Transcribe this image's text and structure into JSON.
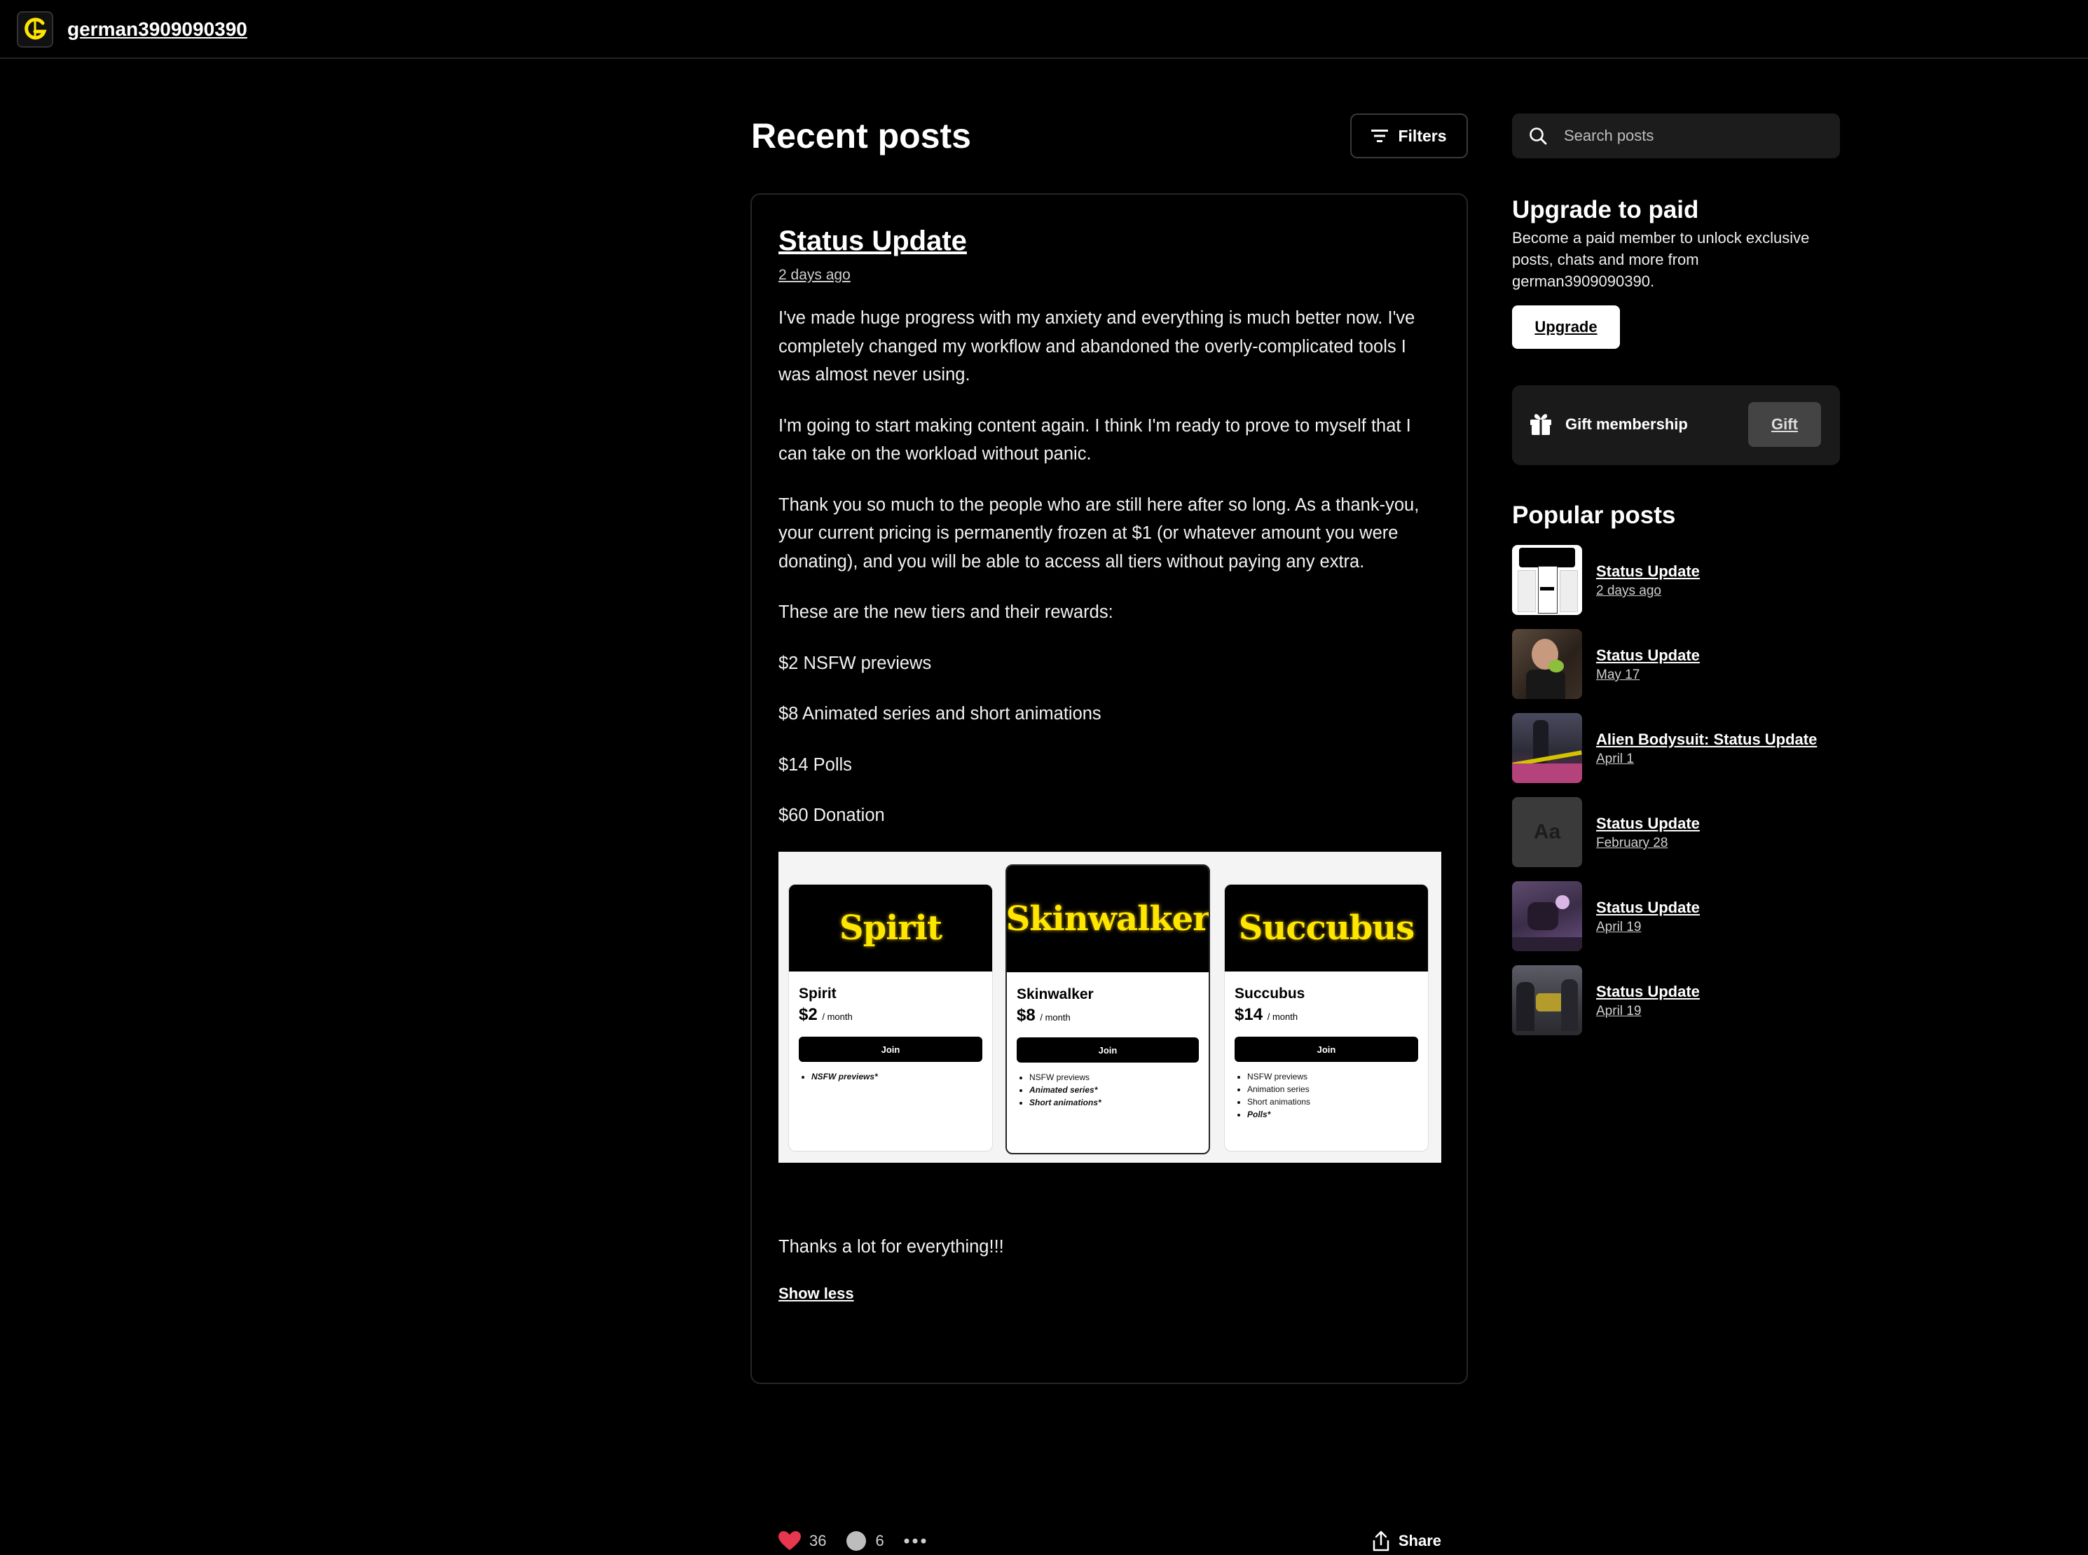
{
  "creator": {
    "name": "german3909090390"
  },
  "main": {
    "heading": "Recent posts",
    "filters_label": "Filters"
  },
  "post": {
    "title": "Status Update",
    "date": "2 days ago",
    "paragraphs": [
      "I've made huge progress with my anxiety and everything is much better now. I've completely changed my workflow and abandoned the overly-complicated tools I was almost never using.",
      "I'm going to start making content again. I think I'm ready to prove to myself that I can take on the workload without panic.",
      "Thank you so much to the people who are still here after so long. As a thank-you, your current pricing is permanently frozen at $1 (or whatever amount you were donating), and you will be able to access all tiers without paying any extra.",
      "These are the new tiers and their rewards:",
      "$2 NSFW previews",
      "$8 Animated series and short animations",
      "$14 Polls",
      "$60 Donation"
    ],
    "image_tiers": [
      {
        "banner": "Spirit",
        "name": "Spirit",
        "price": "$2",
        "per": "/ month",
        "join": "Join",
        "perks": [
          {
            "text": "NSFW previews*",
            "em": true
          }
        ]
      },
      {
        "banner": "Skinwalker",
        "name": "Skinwalker",
        "price": "$8",
        "per": "/ month",
        "join": "Join",
        "perks": [
          {
            "text": "NSFW previews",
            "em": false
          },
          {
            "text": "Animated series*",
            "em": true
          },
          {
            "text": "Short animations*",
            "em": true
          }
        ]
      },
      {
        "banner": "Succubus",
        "name": "Succubus",
        "price": "$14",
        "per": "/ month",
        "join": "Join",
        "perks": [
          {
            "text": "NSFW previews",
            "em": false
          },
          {
            "text": "Animation series",
            "em": false
          },
          {
            "text": "Short animations",
            "em": false
          },
          {
            "text": "Polls*",
            "em": true
          }
        ]
      }
    ],
    "closing": "Thanks a lot for everything!!!",
    "show_less": "Show less",
    "likes": "36",
    "comments": "6",
    "share_label": "Share"
  },
  "sidebar": {
    "search_placeholder": "Search posts",
    "upgrade": {
      "title": "Upgrade to paid",
      "description": "Become a paid member to unlock exclusive posts, chats and more from german3909090390.",
      "button": "Upgrade"
    },
    "gift": {
      "label": "Gift membership",
      "button": "Gift"
    },
    "popular": {
      "title": "Popular posts",
      "items": [
        {
          "title": "Status Update",
          "date": "2 days ago",
          "thumb": "tiers-screenshot"
        },
        {
          "title": "Status Update",
          "date": "May 17",
          "thumb": "character-photo"
        },
        {
          "title": "Alien Bodysuit: Status Update",
          "date": "April 1",
          "thumb": "scene-render"
        },
        {
          "title": "Status Update",
          "date": "February 28",
          "thumb": "text-placeholder",
          "placeholder_text": "Aa"
        },
        {
          "title": "Status Update",
          "date": "April 19",
          "thumb": "scene-render-purple"
        },
        {
          "title": "Status Update",
          "date": "April 19",
          "thumb": "scene-render-car"
        }
      ]
    }
  },
  "colors": {
    "background": "#000000",
    "accent_yellow": "#ffe600",
    "heart_red": "#e8364f",
    "card_border": "#262626"
  }
}
